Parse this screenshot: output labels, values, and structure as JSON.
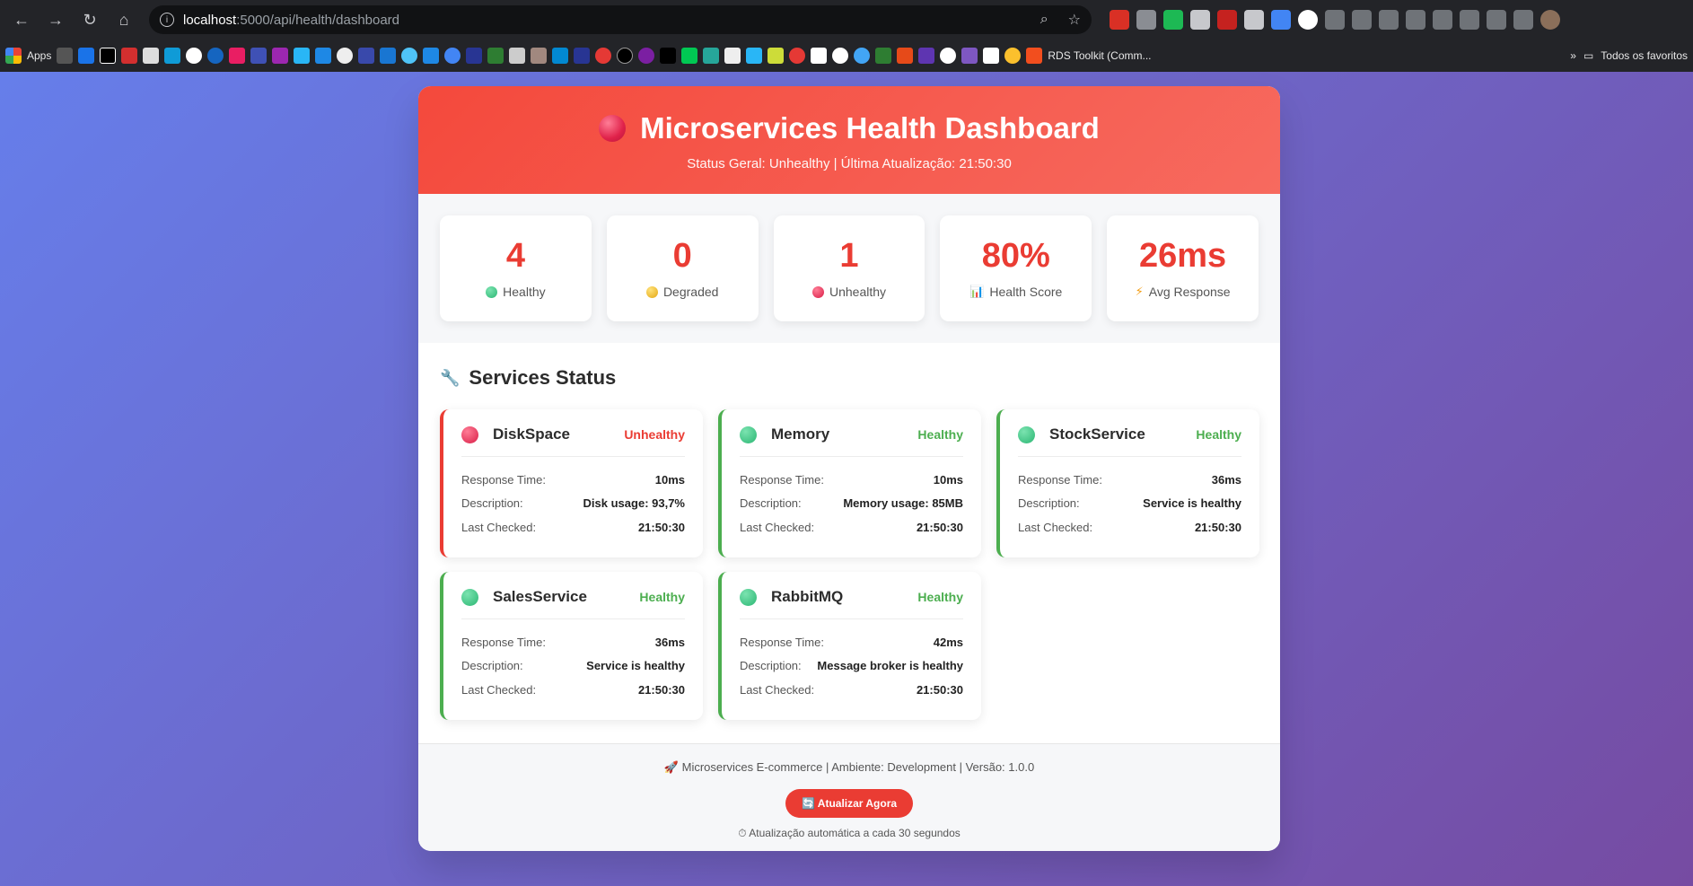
{
  "browser": {
    "url_host": "localhost",
    "url_path": ":5000/api/health/dashboard",
    "bookmarks_apps_label": "Apps",
    "bookmark_rds": "RDS Toolkit (Comm...",
    "bookmark_all": "Todos os favoritos"
  },
  "header": {
    "title": "Microservices Health Dashboard",
    "subtitle": "Status Geral: Unhealthy | Última Atualização: 21:50:30"
  },
  "stats": [
    {
      "value": "4",
      "label": "Healthy",
      "icon": "green-dot"
    },
    {
      "value": "0",
      "label": "Degraded",
      "icon": "yellow-dot"
    },
    {
      "value": "1",
      "label": "Unhealthy",
      "icon": "red-dot"
    },
    {
      "value": "80%",
      "label": "Health Score",
      "icon": "bar-chart-icon"
    },
    {
      "value": "26ms",
      "label": "Avg Response",
      "icon": "lightning-icon"
    }
  ],
  "services_title": "Services Status",
  "field_labels": {
    "response_time": "Response Time:",
    "description": "Description:",
    "last_checked": "Last Checked:"
  },
  "services": [
    {
      "name": "DiskSpace",
      "status": "Unhealthy",
      "response_time": "10ms",
      "description": "Disk usage: 93,7%",
      "last_checked": "21:50:30"
    },
    {
      "name": "Memory",
      "status": "Healthy",
      "response_time": "10ms",
      "description": "Memory usage: 85MB",
      "last_checked": "21:50:30"
    },
    {
      "name": "StockService",
      "status": "Healthy",
      "response_time": "36ms",
      "description": "Service is healthy",
      "last_checked": "21:50:30"
    },
    {
      "name": "SalesService",
      "status": "Healthy",
      "response_time": "36ms",
      "description": "Service is healthy",
      "last_checked": "21:50:30"
    },
    {
      "name": "RabbitMQ",
      "status": "Healthy",
      "response_time": "42ms",
      "description": "Message broker is healthy",
      "last_checked": "21:50:30"
    }
  ],
  "footer": {
    "info": "Microservices E-commerce | Ambiente: Development | Versão: 1.0.0",
    "button": "Atualizar Agora",
    "auto": "Atualização automática a cada 30 segundos"
  },
  "colors": {
    "accent": "#ea3c33",
    "healthy": "#4cae4f",
    "background_start": "#667eea",
    "background_end": "#764ba2"
  }
}
